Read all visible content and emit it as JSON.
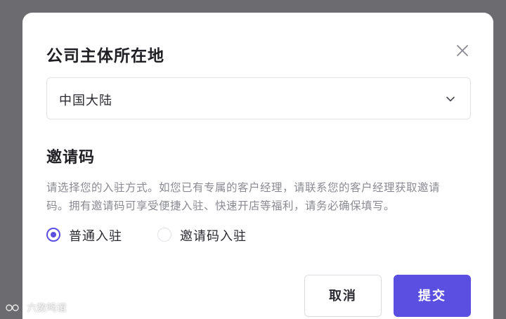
{
  "dialog": {
    "title": "公司主体所在地",
    "close_icon": "close-icon"
  },
  "region_select": {
    "value": "中国大陆",
    "chevron_icon": "chevron-down-icon"
  },
  "invite_section": {
    "title": "邀请码",
    "description": "请选择您的入驻方式。如您已有专属的客户经理，请联系您的客户经理获取邀请码。拥有邀请码可享受便捷入驻、快速开店等福利，请务必确保填写。",
    "options": [
      {
        "label": "普通入驻",
        "checked": true
      },
      {
        "label": "邀请码入驻",
        "checked": false
      }
    ]
  },
  "actions": {
    "cancel_label": "取消",
    "submit_label": "提交"
  },
  "colors": {
    "accent": "#5a4fe0",
    "text_primary": "#1f1f24",
    "text_secondary": "#8a8a92",
    "border": "#e2e2e6",
    "backdrop": "#6c6c70"
  },
  "watermark": {
    "text": "六数鸣谊"
  }
}
